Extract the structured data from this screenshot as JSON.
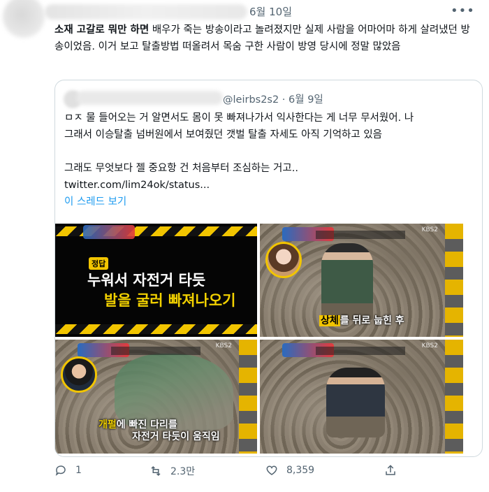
{
  "tweet": {
    "date": "6월 10일",
    "text_bold": "소재 고갈로 뭐만 하면",
    "text_rest": " 배우가 죽는 방송이라고 놀려졌지만 실제 사람을 어마어마 하게 살려냈던 방송이었음. 이거 보고 탈출방법 떠올려서 목숨 구한 사람이 방영 당시에 정말 많았음",
    "more_icon": "more-horizontal-icon"
  },
  "quote": {
    "handle_date": "@leirbs2s2 · 6월 9일",
    "text_line1": "ㅁㅈ 물 들어오는 거 알면서도 몸이 못 빠져나가서 익사한다는 게 너무 무서웠어. 나",
    "text_line2": "그래서 이승탈출 넘버원에서 보여줬던 갯벌 탈출 자세도 아직 기억하고 있음",
    "text_line3": "그래도 무엇보다 젤 중요항 건 처음부터 조심하는 거고..",
    "text_line4": "twitter.com/lim24ok/status...",
    "thread_link": "이 스레드 보기",
    "images": {
      "img1_badge": "정답",
      "img1_line1": "누워서 자전거 타듯",
      "img1_line2": "발을 굴러 빠져나오기",
      "img2_caption_hl": "상체",
      "img2_caption_rest": "를 뒤로 눕힌 후",
      "img3_line1_hl": "개펄",
      "img3_line1_rest": "에 빠진 다리를",
      "img3_line2": "자전거 타듯이 움직임",
      "watermark": "KBS2"
    }
  },
  "actions": {
    "reply_count": "1",
    "retweet_count": "2.3만",
    "like_count": "8,359",
    "icons": [
      "reply-icon",
      "retweet-icon",
      "like-icon",
      "share-icon"
    ]
  },
  "colors": {
    "accent": "#1d9bf0",
    "muted": "#536471",
    "hazard_yellow": "#f2c500"
  }
}
